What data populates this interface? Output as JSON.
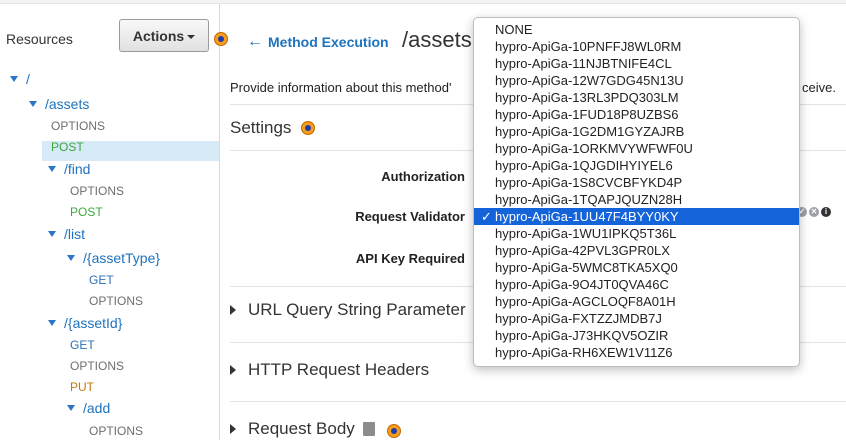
{
  "sidebar": {
    "title": "Resources",
    "actions_label": "Actions",
    "tree": [
      {
        "label": "/",
        "kind": "path"
      },
      {
        "label": "/assets",
        "kind": "path"
      },
      {
        "label": "OPTIONS",
        "kind": "method"
      },
      {
        "label": "POST",
        "kind": "method"
      },
      {
        "label": "/find",
        "kind": "path"
      },
      {
        "label": "OPTIONS",
        "kind": "method"
      },
      {
        "label": "POST",
        "kind": "method"
      },
      {
        "label": "/list",
        "kind": "path"
      },
      {
        "label": "/{assetType}",
        "kind": "path"
      },
      {
        "label": "GET",
        "kind": "method"
      },
      {
        "label": "OPTIONS",
        "kind": "method"
      },
      {
        "label": "/{assetId}",
        "kind": "path"
      },
      {
        "label": "GET",
        "kind": "method"
      },
      {
        "label": "OPTIONS",
        "kind": "method"
      },
      {
        "label": "PUT",
        "kind": "method"
      },
      {
        "label": "/add",
        "kind": "path"
      },
      {
        "label": "OPTIONS",
        "kind": "method"
      }
    ]
  },
  "header": {
    "back_label": "Method Execution",
    "resource_path": "/assets"
  },
  "main": {
    "description": "Provide information about this method'",
    "description_end": "ceive.",
    "settings_title": "Settings",
    "authorization_label": "Authorization",
    "request_validator_label": "Request Validator",
    "api_key_label": "API Key Required",
    "sections": [
      "URL Query String Parameter",
      "HTTP Request Headers",
      "Request Body"
    ]
  },
  "dropdown": {
    "selected": "hypro-ApiGa-1UU47F4BYY0KY",
    "options": [
      "NONE",
      "hypro-ApiGa-10PNFFJ8WL0RM",
      "hypro-ApiGa-11NJBTNIFE4CL",
      "hypro-ApiGa-12W7GDG45N13U",
      "hypro-ApiGa-13RL3PDQ303LM",
      "hypro-ApiGa-1FUD18P8UZBS6",
      "hypro-ApiGa-1G2DM1GYZAJRB",
      "hypro-ApiGa-1ORKMVYWFWF0U",
      "hypro-ApiGa-1QJGDIHYIYEL6",
      "hypro-ApiGa-1S8CVCBFYKD4P",
      "hypro-ApiGa-1TQAPJQUZN28H",
      "hypro-ApiGa-1UU47F4BYY0KY",
      "hypro-ApiGa-1WU1IPKQ5T36L",
      "hypro-ApiGa-42PVL3GPR0LX",
      "hypro-ApiGa-5WMC8TKA5XQ0",
      "hypro-ApiGa-9O4JT0QVA46C",
      "hypro-ApiGa-AGCLOQF8A01H",
      "hypro-ApiGa-FXTZZJMDB7J",
      "hypro-ApiGa-J73HKQV5OZIR",
      "hypro-ApiGa-RH6XEW1V11Z6"
    ]
  },
  "icons": {
    "info_dot": "info-dot-icon",
    "back": "arrow-left-icon",
    "check": "checkmark-icon",
    "book": "book-icon"
  },
  "colors": {
    "link": "#1e73be",
    "post": "#3da73d",
    "put": "#c27a0a",
    "get": "#2c6fb5",
    "selection": "#1463d9",
    "info_dot": "#f79c1e"
  }
}
